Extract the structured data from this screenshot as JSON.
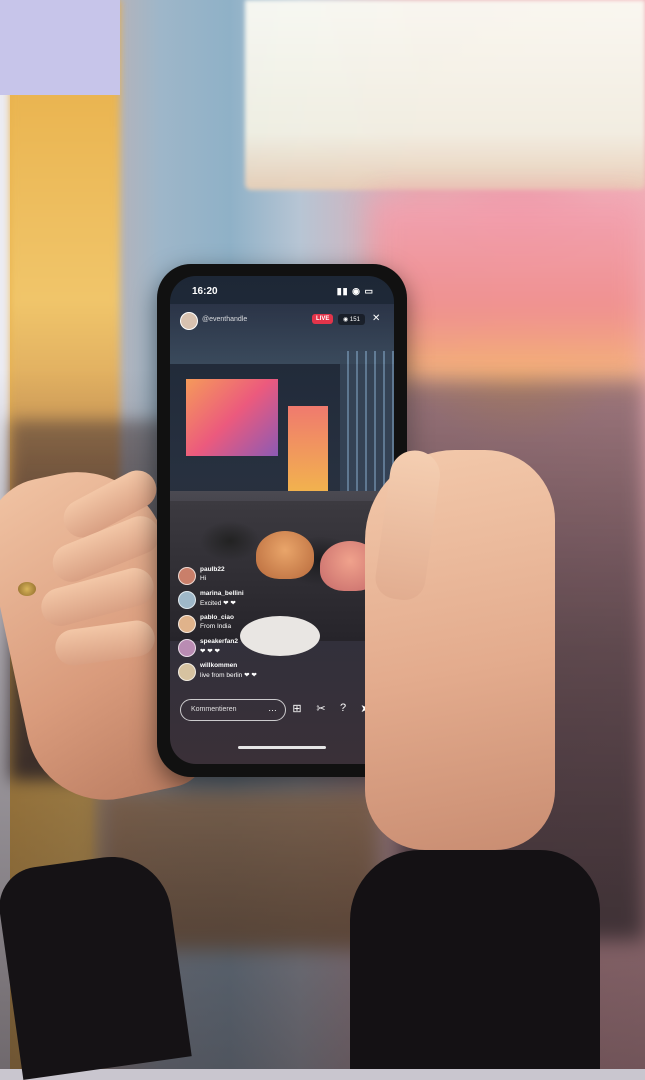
{
  "phone": {
    "status_time": "16:20",
    "status_icons": "▮▮ ◉ ▭"
  },
  "live": {
    "username": "@eventhandle",
    "live_badge": "LIVE",
    "viewer_count": "◉ 151"
  },
  "comments": [
    {
      "name": "paulb22",
      "text": "Hi",
      "avatar_color": "#c97f6a"
    },
    {
      "name": "marina_bellini",
      "text": "Excited ❤ ❤",
      "avatar_color": "#9fb8c9"
    },
    {
      "name": "pablo_ciao",
      "text": "From India",
      "avatar_color": "#e0b38b"
    },
    {
      "name": "speakerfan2",
      "text": "❤ ❤ ❤",
      "avatar_color": "#b98cb3"
    },
    {
      "name": "willkommen",
      "text": "live from berlin ❤ ❤",
      "avatar_color": "#d6c2a0"
    }
  ],
  "bottom": {
    "comment_placeholder": "Kommentieren",
    "more": "…",
    "icons": [
      "add-icon",
      "tools-icon",
      "question-icon",
      "send-icon"
    ]
  },
  "colors": {
    "live_red": "#e3344a",
    "phone_body": "#111111",
    "accent_lilac": "#c7c5ea"
  }
}
